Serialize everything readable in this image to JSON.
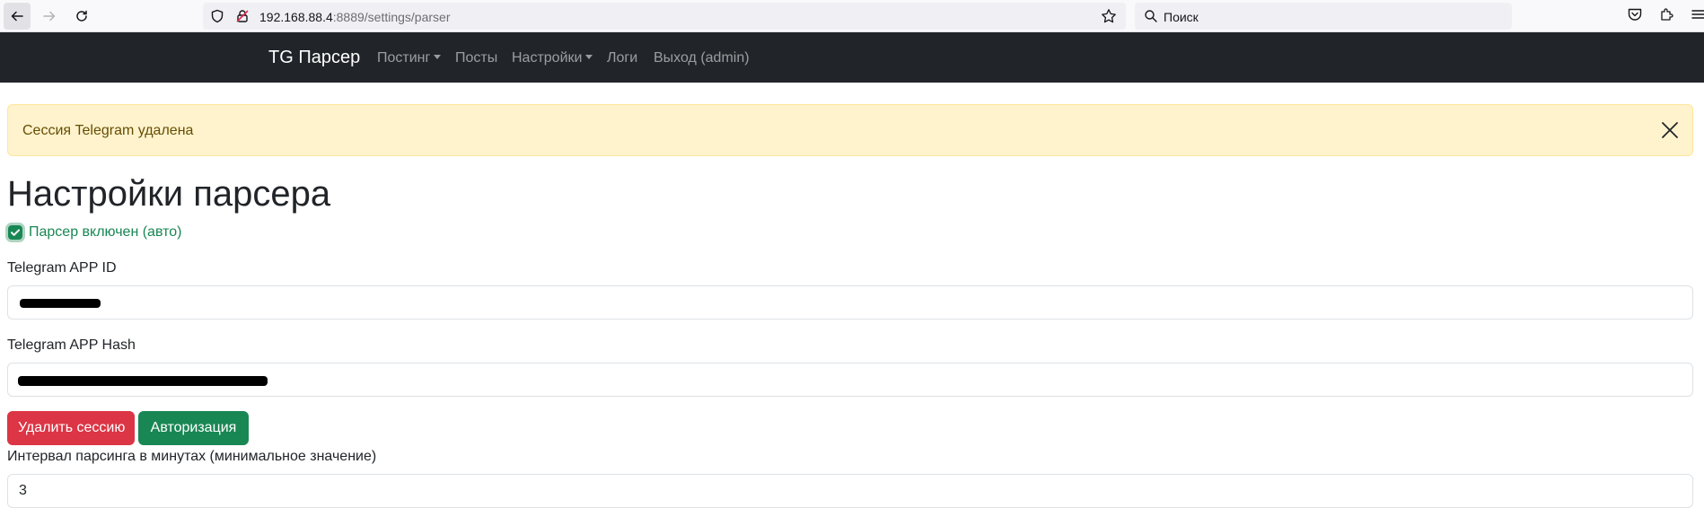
{
  "browser": {
    "url_host": "192.168.88.4",
    "url_path": ":8889/settings/parser",
    "search_placeholder": "Поиск"
  },
  "navbar": {
    "brand": "TG Парсер",
    "items": [
      {
        "label": "Постинг",
        "dropdown": true
      },
      {
        "label": "Посты",
        "dropdown": false
      },
      {
        "label": "Настройки",
        "dropdown": true
      },
      {
        "label": "Логи",
        "dropdown": false
      },
      {
        "label": "Выход (admin)",
        "dropdown": false
      }
    ]
  },
  "alert": {
    "message": "Сессия Telegram удалена"
  },
  "page": {
    "title": "Настройки парсера",
    "parser_enabled_label": "Парсер включен (авто)",
    "parser_enabled": true
  },
  "fields": {
    "app_id": {
      "label": "Telegram APP ID",
      "value": ""
    },
    "app_hash": {
      "label": "Telegram APP Hash",
      "value": ""
    },
    "interval": {
      "label": "Интервал парсинга в минутах (минимальное значение)",
      "value": "3"
    }
  },
  "buttons": {
    "delete_session": "Удалить сессию",
    "authorize": "Авторизация"
  },
  "colors": {
    "navbar_bg": "#212529",
    "alert_bg": "#fff3cd",
    "success": "#198754",
    "danger": "#dc3545"
  }
}
